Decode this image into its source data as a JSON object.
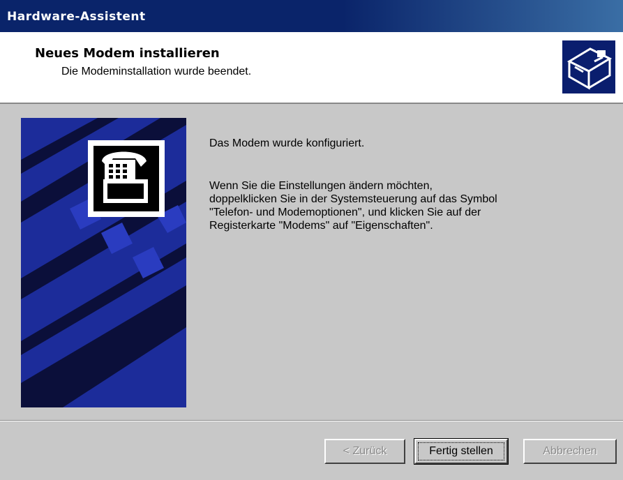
{
  "window": {
    "title": "Hardware-Assistent"
  },
  "header": {
    "title": "Neues Modem installieren",
    "subtitle": "Die Modeminstallation wurde beendet."
  },
  "content": {
    "message1": "Das Modem wurde konfiguriert.",
    "message2_lines": [
      "Wenn Sie die Einstellungen ändern möchten,",
      "doppelklicken Sie in der Systemsteuerung auf das Symbol",
      "\"Telefon- und Modemoptionen\", und klicken Sie auf der",
      "Registerkarte \"Modems\" auf  \"Eigenschaften\"."
    ]
  },
  "buttons": {
    "back": "< Zurück",
    "finish": "Fertig stellen",
    "cancel": "Abbrechen"
  },
  "icons": {
    "header": "hardware-icon",
    "side": "telephone-modem-icon"
  },
  "colors": {
    "titlebar": "#0a246a",
    "side_art": "#1c2c9a",
    "dialog_bg": "#c8c8c8"
  }
}
